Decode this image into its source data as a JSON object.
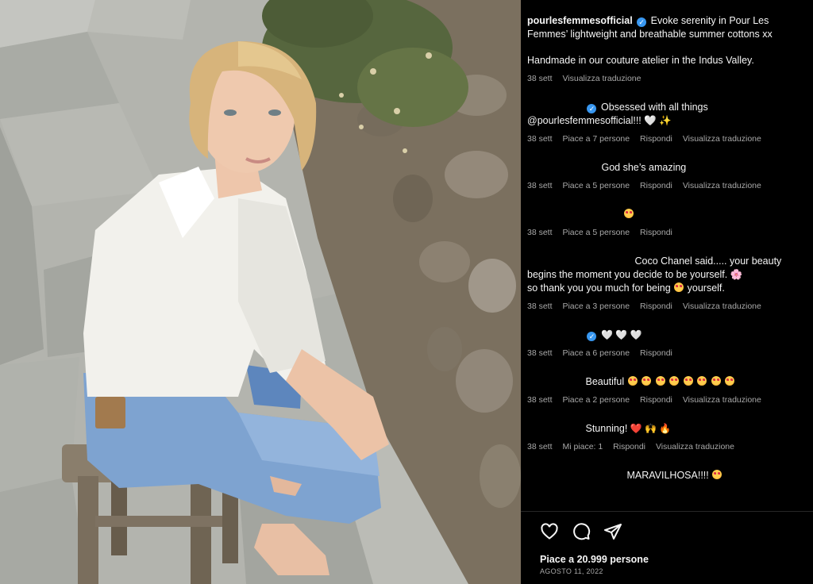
{
  "post": {
    "username": "pourlesfemmesofficial",
    "caption_line1": "Evoke serenity in Pour Les Femmes’ lightweight and breathable summer cottons xx",
    "caption_line2": "Handmade in our couture atelier in the Indus Valley.",
    "age": "38 sett",
    "translate": "Visualizza traduzione"
  },
  "comments": [
    {
      "text1": "Obsessed with all things",
      "text2": "@pourlesfemmesofficial!!!",
      "emoji": "🤍 ✨",
      "age": "38 sett",
      "likes": "Piace a 7 persone",
      "reply": "Rispondi",
      "translate": "Visualizza traduzione"
    },
    {
      "text1": "God she’s amazing",
      "age": "38 sett",
      "likes": "Piace a 5 persone",
      "reply": "Rispondi",
      "translate": "Visualizza traduzione"
    },
    {
      "text1": "",
      "age": "38 sett",
      "likes": "Piace a 5 persone",
      "reply": "Rispondi"
    },
    {
      "text1": "Coco Chanel said..... your beauty",
      "text2": "begins the moment you decide to be yourself. 🌸",
      "text3a": "so thank you you much for being",
      "text3b": "yourself.",
      "age": "38 sett",
      "likes": "Piace a 3 persone",
      "reply": "Rispondi",
      "translate": "Visualizza traduzione"
    },
    {
      "text1": "🤍 🤍 🤍",
      "age": "38 sett",
      "likes": "Piace a 6 persone",
      "reply": "Rispondi"
    },
    {
      "text1": "Beautiful",
      "age": "38 sett",
      "likes": "Piace a 2 persone",
      "reply": "Rispondi",
      "translate": "Visualizza traduzione"
    },
    {
      "text1": "Stunning!",
      "emoji": "❤️ 🙌 🔥",
      "age": "38 sett",
      "likes": "Mi piace: 1",
      "reply": "Rispondi",
      "translate": "Visualizza traduzione"
    },
    {
      "text1": "MARAVILHOSA!!!!"
    }
  ],
  "footer": {
    "likes": "Piace a 20.999 persone",
    "date": "AGOSTO 11, 2022"
  },
  "icons": [
    "heart-icon",
    "comment-icon",
    "share-icon"
  ],
  "colors": {
    "verified": "#3897f0",
    "meta": "#a8a8a8",
    "background": "#000000"
  }
}
